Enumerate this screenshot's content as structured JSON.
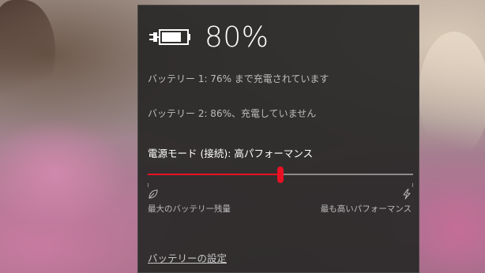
{
  "battery": {
    "percent_label": "80%",
    "icon": "battery-plugged-icon",
    "level": 0.8
  },
  "batteries": [
    {
      "text": "バッテリー 1: 76% まで充電されています"
    },
    {
      "text": "バッテリー 2: 86%、充電していません"
    }
  ],
  "power_mode": {
    "label": "電源モード (接続): 高パフォーマンス",
    "slider_level": 0.5,
    "accent_color": "#e81123",
    "min_label": "最大のバッテリー残量",
    "min_icon": "leaf-icon",
    "max_label": "最も高いパフォーマンス",
    "max_icon": "lightning-icon"
  },
  "settings_link": "バッテリーの設定"
}
